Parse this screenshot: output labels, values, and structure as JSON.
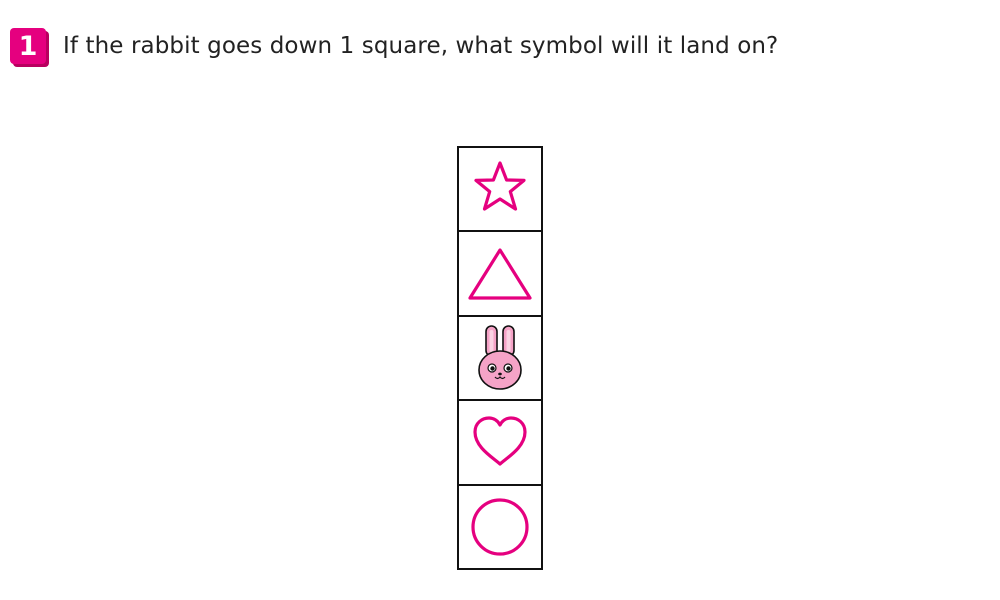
{
  "question": {
    "number": "1",
    "text": "If the rabbit goes down 1 square, what symbol will it land on?"
  },
  "grid": {
    "cells": [
      {
        "symbol": "star-icon"
      },
      {
        "symbol": "triangle-icon"
      },
      {
        "symbol": "rabbit-icon"
      },
      {
        "symbol": "heart-icon"
      },
      {
        "symbol": "circle-icon"
      }
    ]
  },
  "colors": {
    "accent": "#e5007f",
    "rabbit_face": "#f5a3c7",
    "border": "#111111"
  }
}
